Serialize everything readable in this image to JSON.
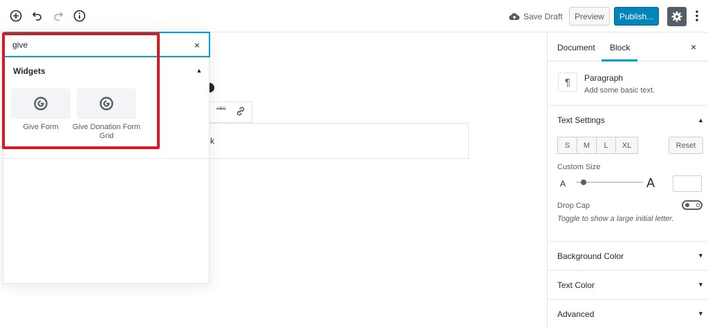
{
  "topbar": {
    "save_draft": "Save Draft",
    "preview": "Preview",
    "publish": "Publish..."
  },
  "canvas": {
    "paragraph_text": "k"
  },
  "inserter": {
    "search_value": "give",
    "clear_symbol": "×",
    "panel_title": "Widgets",
    "panel_toggle": "▲",
    "blocks": [
      {
        "label": "Give Form",
        "icon": "give-icon"
      },
      {
        "label": "Give Donation Form Grid",
        "icon": "give-icon"
      }
    ]
  },
  "sidebar": {
    "tabs": [
      "Document",
      "Block"
    ],
    "active_tab": "Block",
    "close": "×",
    "block_card": {
      "icon": "¶",
      "title": "Paragraph",
      "description": "Add some basic text."
    },
    "text_settings": {
      "title": "Text Settings",
      "arrow": "▲",
      "sizes": [
        "S",
        "M",
        "L",
        "XL"
      ],
      "reset": "Reset",
      "custom_size_label": "Custom Size",
      "a_small": "A",
      "a_large": "A",
      "custom_size_value": 0.1,
      "drop_cap_label": "Drop Cap",
      "drop_cap_help": "Toggle to show a large initial letter."
    },
    "panels": [
      {
        "title": "Background Color",
        "arrow": "▼"
      },
      {
        "title": "Text Color",
        "arrow": "▼"
      },
      {
        "title": "Advanced",
        "arrow": "▼"
      }
    ]
  },
  "colors": {
    "accent": "#00a0d2",
    "publish": "#0085ba",
    "highlight": "#e0161d"
  }
}
